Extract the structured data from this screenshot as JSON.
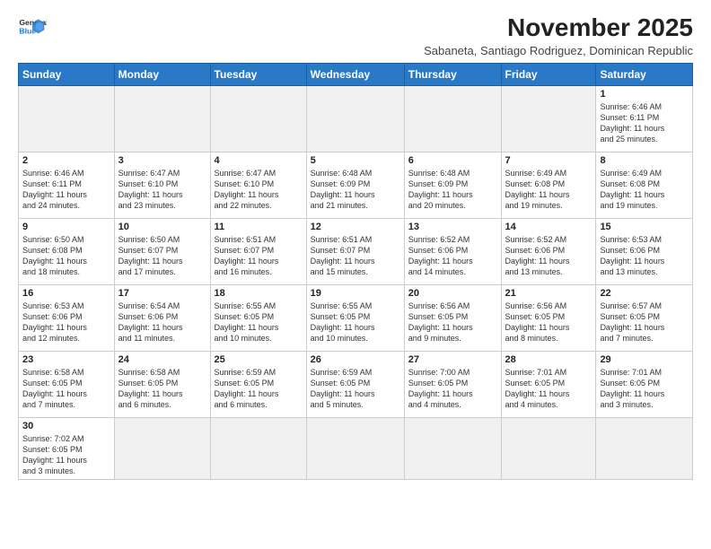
{
  "header": {
    "logo_line1": "General",
    "logo_line2": "Blue",
    "month_title": "November 2025",
    "subtitle": "Sabaneta, Santiago Rodriguez, Dominican Republic"
  },
  "weekdays": [
    "Sunday",
    "Monday",
    "Tuesday",
    "Wednesday",
    "Thursday",
    "Friday",
    "Saturday"
  ],
  "weeks": [
    [
      {
        "day": "",
        "info": ""
      },
      {
        "day": "",
        "info": ""
      },
      {
        "day": "",
        "info": ""
      },
      {
        "day": "",
        "info": ""
      },
      {
        "day": "",
        "info": ""
      },
      {
        "day": "",
        "info": ""
      },
      {
        "day": "1",
        "info": "Sunrise: 6:46 AM\nSunset: 6:11 PM\nDaylight: 11 hours\nand 25 minutes."
      }
    ],
    [
      {
        "day": "2",
        "info": "Sunrise: 6:46 AM\nSunset: 6:11 PM\nDaylight: 11 hours\nand 24 minutes."
      },
      {
        "day": "3",
        "info": "Sunrise: 6:47 AM\nSunset: 6:10 PM\nDaylight: 11 hours\nand 23 minutes."
      },
      {
        "day": "4",
        "info": "Sunrise: 6:47 AM\nSunset: 6:10 PM\nDaylight: 11 hours\nand 22 minutes."
      },
      {
        "day": "5",
        "info": "Sunrise: 6:48 AM\nSunset: 6:09 PM\nDaylight: 11 hours\nand 21 minutes."
      },
      {
        "day": "6",
        "info": "Sunrise: 6:48 AM\nSunset: 6:09 PM\nDaylight: 11 hours\nand 20 minutes."
      },
      {
        "day": "7",
        "info": "Sunrise: 6:49 AM\nSunset: 6:08 PM\nDaylight: 11 hours\nand 19 minutes."
      },
      {
        "day": "8",
        "info": "Sunrise: 6:49 AM\nSunset: 6:08 PM\nDaylight: 11 hours\nand 19 minutes."
      }
    ],
    [
      {
        "day": "9",
        "info": "Sunrise: 6:50 AM\nSunset: 6:08 PM\nDaylight: 11 hours\nand 18 minutes."
      },
      {
        "day": "10",
        "info": "Sunrise: 6:50 AM\nSunset: 6:07 PM\nDaylight: 11 hours\nand 17 minutes."
      },
      {
        "day": "11",
        "info": "Sunrise: 6:51 AM\nSunset: 6:07 PM\nDaylight: 11 hours\nand 16 minutes."
      },
      {
        "day": "12",
        "info": "Sunrise: 6:51 AM\nSunset: 6:07 PM\nDaylight: 11 hours\nand 15 minutes."
      },
      {
        "day": "13",
        "info": "Sunrise: 6:52 AM\nSunset: 6:06 PM\nDaylight: 11 hours\nand 14 minutes."
      },
      {
        "day": "14",
        "info": "Sunrise: 6:52 AM\nSunset: 6:06 PM\nDaylight: 11 hours\nand 13 minutes."
      },
      {
        "day": "15",
        "info": "Sunrise: 6:53 AM\nSunset: 6:06 PM\nDaylight: 11 hours\nand 13 minutes."
      }
    ],
    [
      {
        "day": "16",
        "info": "Sunrise: 6:53 AM\nSunset: 6:06 PM\nDaylight: 11 hours\nand 12 minutes."
      },
      {
        "day": "17",
        "info": "Sunrise: 6:54 AM\nSunset: 6:06 PM\nDaylight: 11 hours\nand 11 minutes."
      },
      {
        "day": "18",
        "info": "Sunrise: 6:55 AM\nSunset: 6:05 PM\nDaylight: 11 hours\nand 10 minutes."
      },
      {
        "day": "19",
        "info": "Sunrise: 6:55 AM\nSunset: 6:05 PM\nDaylight: 11 hours\nand 10 minutes."
      },
      {
        "day": "20",
        "info": "Sunrise: 6:56 AM\nSunset: 6:05 PM\nDaylight: 11 hours\nand 9 minutes."
      },
      {
        "day": "21",
        "info": "Sunrise: 6:56 AM\nSunset: 6:05 PM\nDaylight: 11 hours\nand 8 minutes."
      },
      {
        "day": "22",
        "info": "Sunrise: 6:57 AM\nSunset: 6:05 PM\nDaylight: 11 hours\nand 7 minutes."
      }
    ],
    [
      {
        "day": "23",
        "info": "Sunrise: 6:58 AM\nSunset: 6:05 PM\nDaylight: 11 hours\nand 7 minutes."
      },
      {
        "day": "24",
        "info": "Sunrise: 6:58 AM\nSunset: 6:05 PM\nDaylight: 11 hours\nand 6 minutes."
      },
      {
        "day": "25",
        "info": "Sunrise: 6:59 AM\nSunset: 6:05 PM\nDaylight: 11 hours\nand 6 minutes."
      },
      {
        "day": "26",
        "info": "Sunrise: 6:59 AM\nSunset: 6:05 PM\nDaylight: 11 hours\nand 5 minutes."
      },
      {
        "day": "27",
        "info": "Sunrise: 7:00 AM\nSunset: 6:05 PM\nDaylight: 11 hours\nand 4 minutes."
      },
      {
        "day": "28",
        "info": "Sunrise: 7:01 AM\nSunset: 6:05 PM\nDaylight: 11 hours\nand 4 minutes."
      },
      {
        "day": "29",
        "info": "Sunrise: 7:01 AM\nSunset: 6:05 PM\nDaylight: 11 hours\nand 3 minutes."
      }
    ],
    [
      {
        "day": "30",
        "info": "Sunrise: 7:02 AM\nSunset: 6:05 PM\nDaylight: 11 hours\nand 3 minutes."
      },
      {
        "day": "",
        "info": ""
      },
      {
        "day": "",
        "info": ""
      },
      {
        "day": "",
        "info": ""
      },
      {
        "day": "",
        "info": ""
      },
      {
        "day": "",
        "info": ""
      },
      {
        "day": "",
        "info": ""
      }
    ]
  ]
}
